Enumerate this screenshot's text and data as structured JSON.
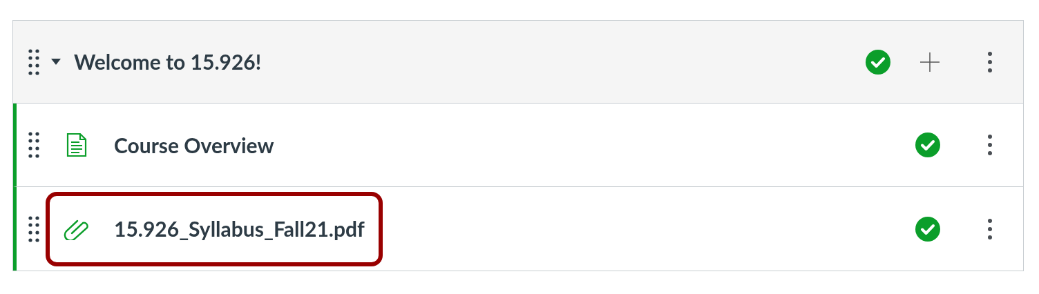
{
  "module": {
    "title": "Welcome to 15.926!",
    "expanded": true,
    "published": true
  },
  "items": [
    {
      "kind": "page",
      "title": "Course Overview",
      "published": true,
      "highlighted": false
    },
    {
      "kind": "file",
      "title": "15.926_Syllabus_Fall21.pdf",
      "published": true,
      "highlighted": true
    }
  ]
}
